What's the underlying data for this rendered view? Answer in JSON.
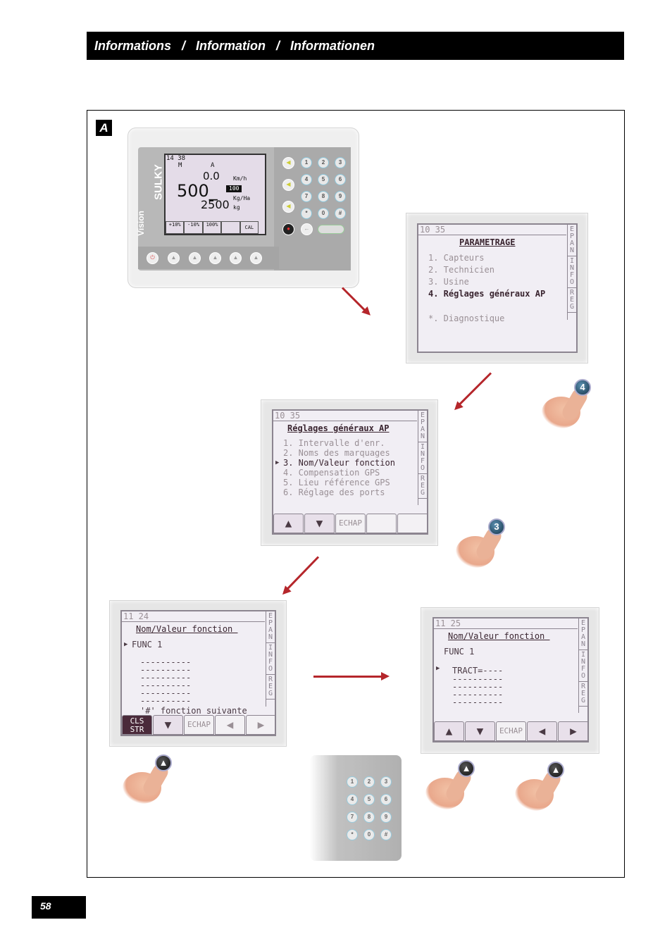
{
  "header": {
    "title": "Informations   /   Information   /   Informationen"
  },
  "figure_label": "A",
  "page_number": "58",
  "accent_color": "#b5262b",
  "device": {
    "brand": "SULKY",
    "model": "Vision",
    "time": "14 38",
    "mode": "M",
    "section": "A",
    "speed": "0.0",
    "speed_unit": "Km/h",
    "rate": "500_",
    "rate_unit": "Kg/Ha",
    "target_badge": "100",
    "weight": "2500",
    "weight_unit": "kg",
    "softkeys": [
      "+10%",
      "-10%",
      "100%",
      "",
      "CAL"
    ],
    "keypad": [
      "1",
      "2",
      "3",
      "4",
      "5",
      "6",
      "7",
      "8",
      "9",
      "*",
      "0",
      "#"
    ]
  },
  "screen1": {
    "time": "10 35",
    "title": "PARAMETRAGE",
    "items": [
      "1. Capteurs",
      "2. Technicien",
      "3. Usine",
      "4. Réglages généraux AP",
      "*. Diagnostique"
    ],
    "selected": 4,
    "tabs": [
      "EPAN",
      "INFO",
      "REG"
    ]
  },
  "screen2": {
    "time": "10 35",
    "title": "Réglages généraux AP",
    "items": [
      "1. Intervalle d'enr.",
      "2. Noms des marquages",
      "3. Nom/Valeur fonction",
      "4. Compensation GPS",
      "5. Lieu référence GPS",
      "6. Réglage des ports"
    ],
    "selected": 3,
    "tabs": [
      "EPAN",
      "INFO",
      "REG"
    ],
    "softkeys": [
      "▲",
      "▼",
      "ECHAP",
      "",
      ""
    ]
  },
  "screen3": {
    "time": "11 24",
    "title": "Nom/Valeur fonction ",
    "func": "FUNC 1",
    "lines": [
      "----------",
      "----------",
      "----------",
      "----------",
      "----------",
      "----------"
    ],
    "hint": "'#' fonction suivante",
    "tabs": [
      "EPAN",
      "INFO",
      "REG"
    ],
    "softkeys": [
      "CLS STR",
      "▼",
      "ECHAP",
      "◀",
      "▶"
    ]
  },
  "screen4": {
    "time": "11 25",
    "title": "Nom/Valeur fonction ",
    "func": "FUNC 1",
    "first_line": "TRACT=----",
    "lines": [
      "----------",
      "----------",
      "----------",
      "----------"
    ],
    "tabs": [
      "EPAN",
      "INFO",
      "REG"
    ],
    "softkeys": [
      "▲",
      "▼",
      "ECHAP",
      "◀",
      "▶"
    ]
  },
  "fingers": [
    {
      "key": "4"
    },
    {
      "key": "3"
    },
    {
      "key": "▲"
    },
    {
      "key": "▲"
    },
    {
      "key": "▲"
    }
  ]
}
